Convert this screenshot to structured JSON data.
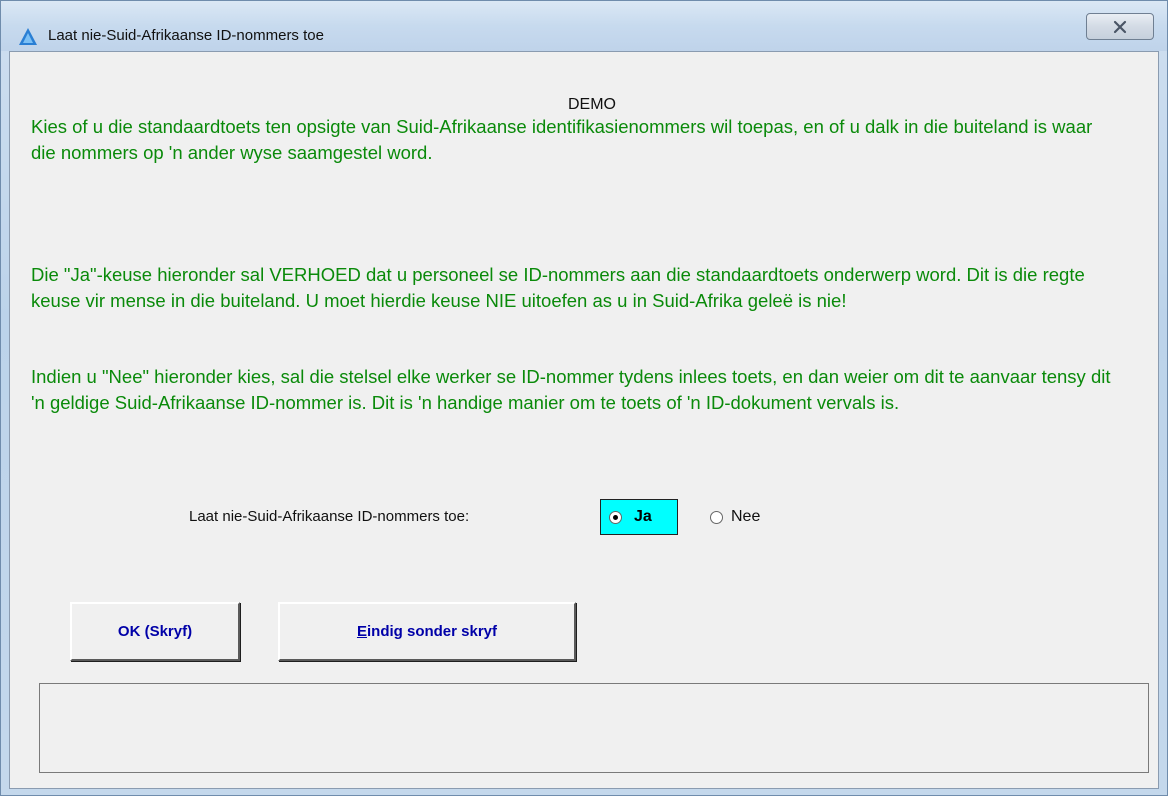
{
  "window": {
    "title": "Laat nie-Suid-Afrikaanse ID-nommers toe",
    "close_glyph": "X"
  },
  "dialog": {
    "demo_label": "DEMO",
    "paragraph_1": "Kies of u die standaardtoets ten opsigte van Suid-Afrikaanse identifikasienommers wil toepas, en of u dalk in die buiteland is waar die nommers op 'n ander wyse saamgestel word.",
    "paragraph_2": "Die \"Ja\"-keuse hieronder sal VERHOED dat u personeel se ID-nommers aan die standaardtoets onderwerp word. Dit is die regte keuse vir mense in die buiteland. U moet hierdie keuse NIE uitoefen as u in Suid-Afrika geleë is nie!",
    "paragraph_3": "Indien u \"Nee\" hieronder kies, sal die stelsel elke werker se ID-nommer tydens inlees toets, en dan weier om dit te aanvaar tensy dit 'n geldige Suid-Afrikaanse ID-nommer is. Dit is 'n handige manier om te toets of 'n ID-dokument vervals is."
  },
  "option": {
    "label": "Laat nie-Suid-Afrikaanse ID-nommers toe:",
    "yes_label": "Ja",
    "no_label": "Nee",
    "selected": "Ja"
  },
  "buttons": {
    "ok_label": "OK (Skryf)",
    "end_first_letter": "E",
    "end_rest": "indig sonder skryf"
  },
  "status": {
    "text": ""
  },
  "colors": {
    "paragraph_text": "#0a8a0a",
    "button_text": "#0000a8",
    "selected_highlight": "#00ffff"
  }
}
